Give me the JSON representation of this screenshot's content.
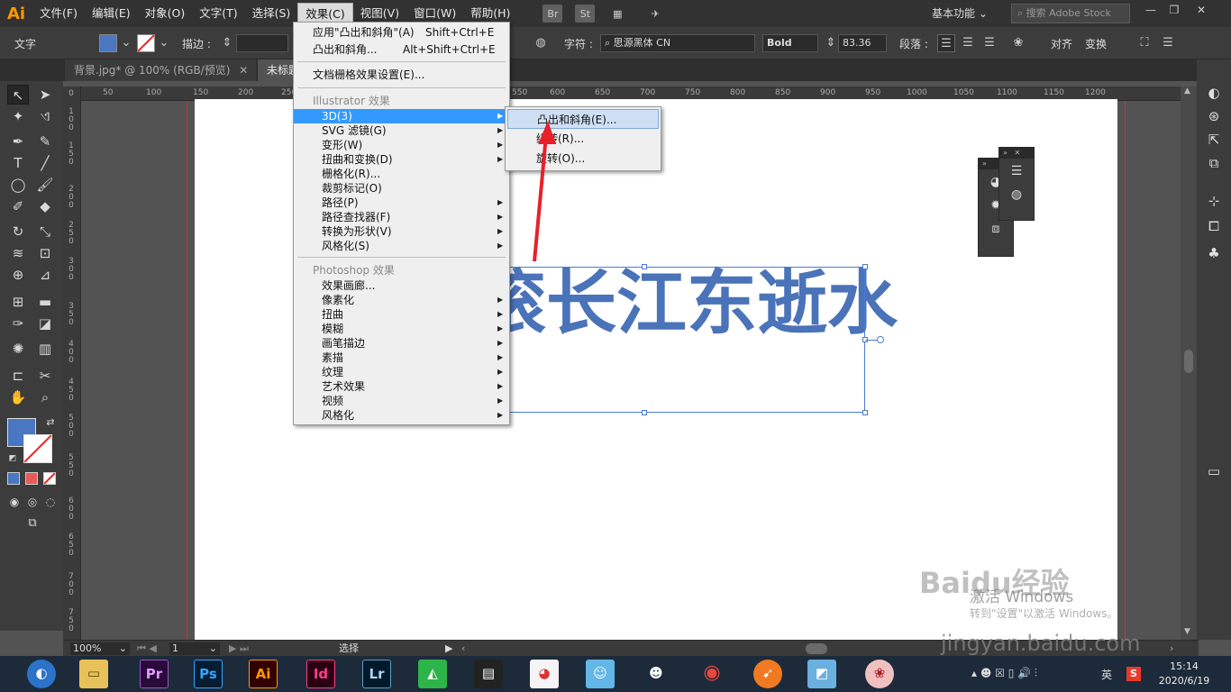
{
  "app": {
    "logo": "Ai"
  },
  "menubar": {
    "items": [
      "文件(F)",
      "编辑(E)",
      "对象(O)",
      "文字(T)",
      "选择(S)",
      "效果(C)",
      "视图(V)",
      "窗口(W)",
      "帮助(H)"
    ],
    "icons": [
      "Br",
      "St"
    ],
    "workspace": "基本功能",
    "search_placeholder": "搜索 Adobe Stock"
  },
  "controlbar": {
    "selection_type": "文字",
    "stroke_label": "描边 :",
    "char_label": "字符 :",
    "font_family": "思源黑体 CN",
    "font_style": "Bold",
    "font_size": "83.36",
    "paragraph_label": "段落 :",
    "align_label": "对齐",
    "transform_label": "变换",
    "fill_color": "#4a77c2"
  },
  "tabs": [
    {
      "label": "背景.jpg* @ 100% (RGB/预览)",
      "close": "✕"
    },
    {
      "label": "未标题"
    }
  ],
  "ruler": {
    "h": [
      "50",
      "100",
      "150",
      "200",
      "250",
      "550",
      "600",
      "650",
      "700",
      "750",
      "800",
      "850",
      "900",
      "950",
      "1000",
      "1050",
      "1100",
      "1150",
      "1200"
    ],
    "v": [
      "0",
      "1 0 0",
      "1 5 0",
      "2 0 0",
      "2 5 0",
      "3 0 0",
      "3 5 0",
      "4 0 0",
      "4 5 0",
      "5 0 0",
      "5 5 0",
      "6 0 0",
      "6 5 0",
      "7 0 0",
      "7 5 0"
    ]
  },
  "canvas": {
    "text": "滚长江东逝水",
    "text_color": "#4a73b9"
  },
  "effect_menu": {
    "apply_label": "应用\"凸出和斜角\"(A)",
    "apply_shortcut": "Shift+Ctrl+E",
    "last_label": "凸出和斜角...",
    "last_shortcut": "Alt+Shift+Ctrl+E",
    "raster_settings": "文档栅格效果设置(E)...",
    "illustrator_header": "Illustrator 效果",
    "illustrator_items": [
      {
        "label": "3D(3)",
        "sub": true,
        "highlighted": true
      },
      {
        "label": "SVG 滤镜(G)",
        "sub": true
      },
      {
        "label": "变形(W)",
        "sub": true
      },
      {
        "label": "扭曲和变换(D)",
        "sub": true
      },
      {
        "label": "栅格化(R)...",
        "sub": false
      },
      {
        "label": "裁剪标记(O)",
        "sub": false
      },
      {
        "label": "路径(P)",
        "sub": true
      },
      {
        "label": "路径查找器(F)",
        "sub": true
      },
      {
        "label": "转换为形状(V)",
        "sub": true
      },
      {
        "label": "风格化(S)",
        "sub": true
      }
    ],
    "photoshop_header": "Photoshop 效果",
    "photoshop_items": [
      {
        "label": "效果画廊...",
        "sub": false
      },
      {
        "label": "像素化",
        "sub": true
      },
      {
        "label": "扭曲",
        "sub": true
      },
      {
        "label": "模糊",
        "sub": true
      },
      {
        "label": "画笔描边",
        "sub": true
      },
      {
        "label": "素描",
        "sub": true
      },
      {
        "label": "纹理",
        "sub": true
      },
      {
        "label": "艺术效果",
        "sub": true
      },
      {
        "label": "视频",
        "sub": true
      },
      {
        "label": "风格化",
        "sub": true
      }
    ]
  },
  "submenu_3d": {
    "items": [
      {
        "label": "凸出和斜角(E)...",
        "highlighted": true
      },
      {
        "label": "绕转(R)..."
      },
      {
        "label": "旋转(O)..."
      }
    ]
  },
  "statusbar": {
    "zoom": "100%",
    "artboard": "1",
    "tool": "选择"
  },
  "watermark": {
    "brand": "Baidu经验",
    "activate": "激活 Windows",
    "activate_sub": "转到\"设置\"以激活 Windows。",
    "url": "jingyan.baidu.com"
  },
  "taskbar": {
    "apps": [
      "Pr",
      "Ps",
      "Ai",
      "Id",
      "Lr"
    ],
    "ime": "英",
    "time": "15:14",
    "date": "2020/6/19"
  },
  "colors": {
    "arrow": "#e8202a",
    "menu_highlight": "#3399ff"
  }
}
